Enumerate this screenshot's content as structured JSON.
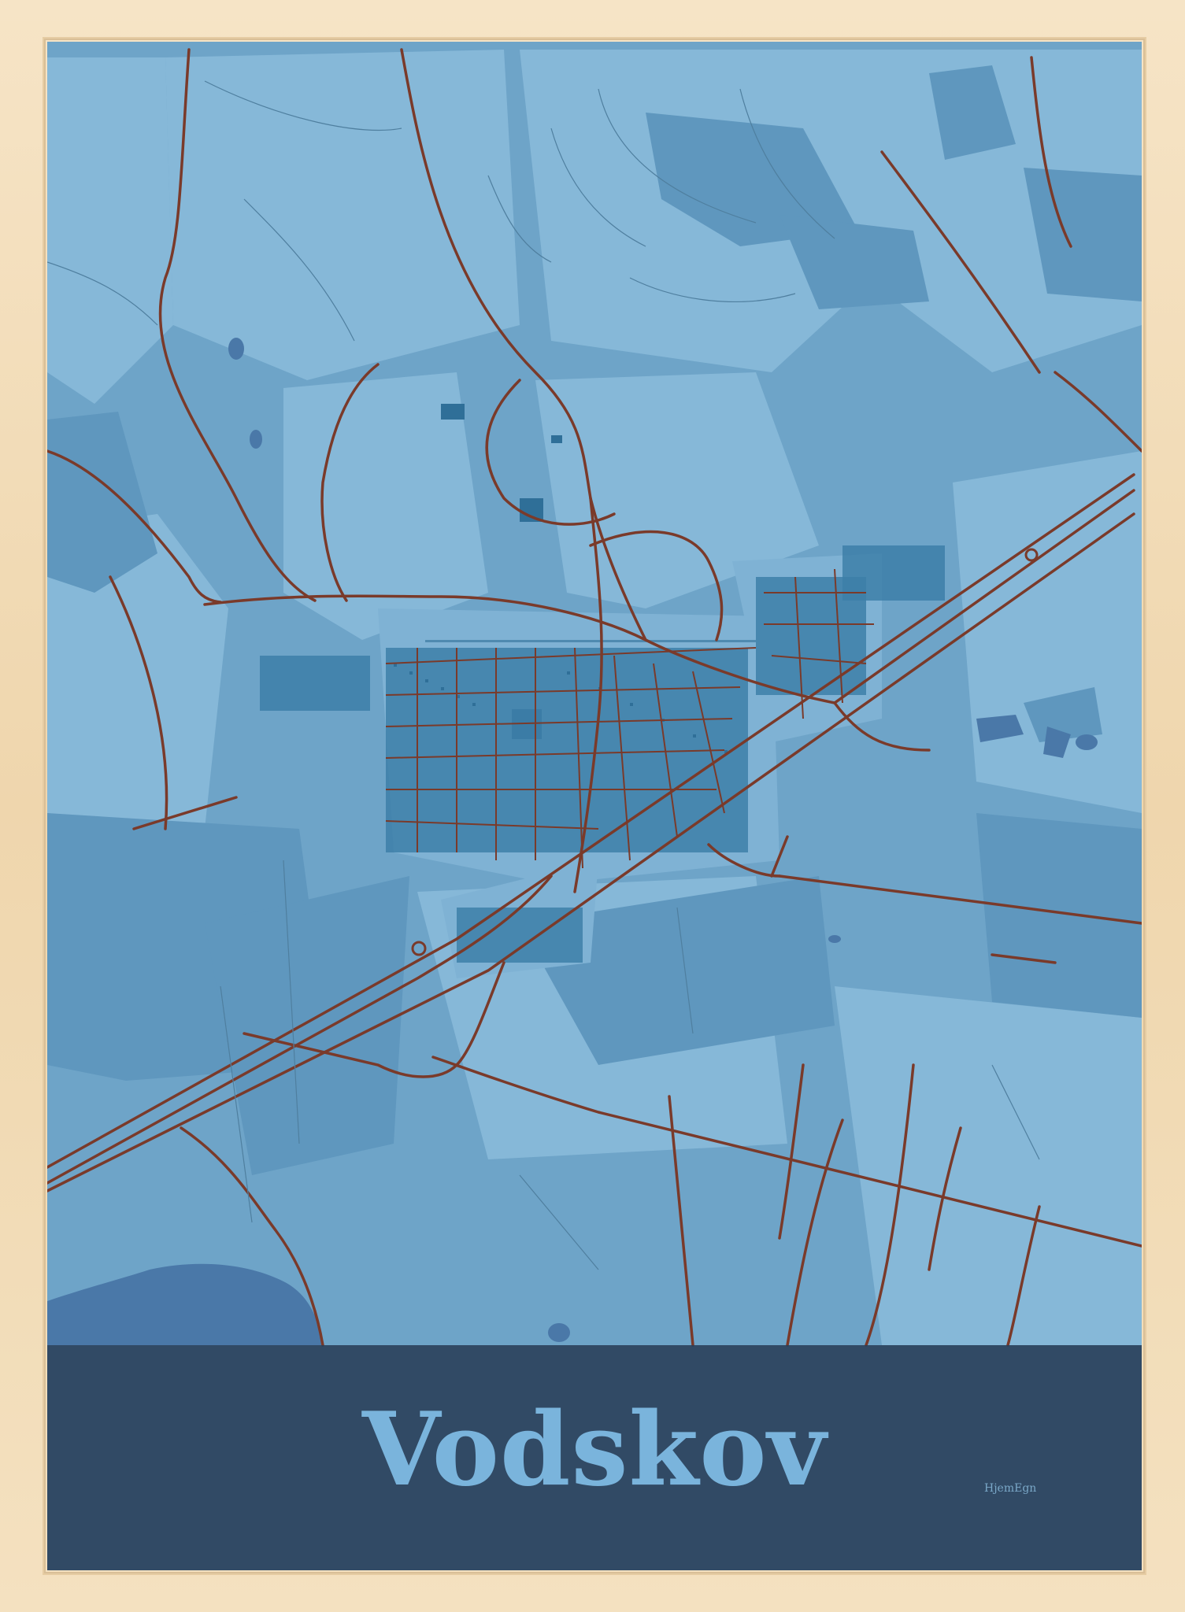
{
  "poster": {
    "city": "Vodskov",
    "brand": "HjemEgn"
  },
  "colors": {
    "frame": "#efd9b4",
    "land": "#6ea4c8",
    "field_light": "#86b8d8",
    "field_dark": "#5f97be",
    "water": "#4a78a8",
    "roads": "#7a3a2a",
    "buildings": "#2f6f98",
    "title_band": "#2b3e56",
    "title_text": "#7ab4dc"
  }
}
